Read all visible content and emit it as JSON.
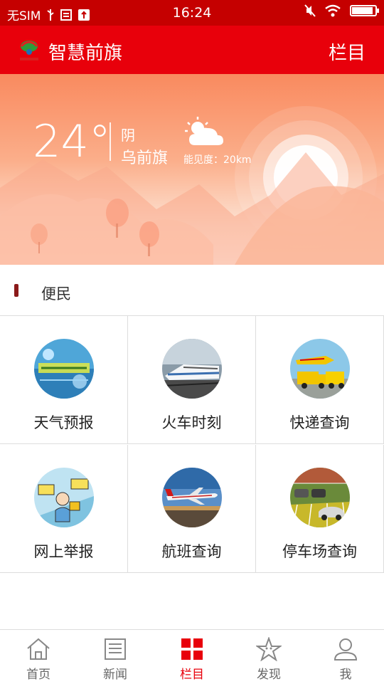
{
  "status": {
    "carrier": "无SIM",
    "time": "16:24",
    "battery_level": 0.9
  },
  "header": {
    "title": "智慧前旗",
    "menu_label": "栏目",
    "brand_color": "#e8000b"
  },
  "weather": {
    "temperature": "24°",
    "condition": "阴",
    "city": "乌前旗",
    "visibility": "能见度：20km",
    "icon": "partly-cloudy-icon"
  },
  "section": {
    "title": "便民"
  },
  "services": [
    {
      "label": "天气预报",
      "icon": "weather-forecast-icon"
    },
    {
      "label": "火车时刻",
      "icon": "train-icon"
    },
    {
      "label": "快递查询",
      "icon": "express-delivery-icon"
    },
    {
      "label": "网上举报",
      "icon": "online-report-icon"
    },
    {
      "label": "航班查询",
      "icon": "flight-icon"
    },
    {
      "label": "停车场查询",
      "icon": "parking-icon"
    }
  ],
  "tabs": [
    {
      "label": "首页",
      "icon": "home-icon",
      "active": false
    },
    {
      "label": "新闻",
      "icon": "news-icon",
      "active": false
    },
    {
      "label": "栏目",
      "icon": "grid-icon",
      "active": true
    },
    {
      "label": "发现",
      "icon": "discover-icon",
      "active": false
    },
    {
      "label": "我",
      "icon": "user-icon",
      "active": false
    }
  ]
}
